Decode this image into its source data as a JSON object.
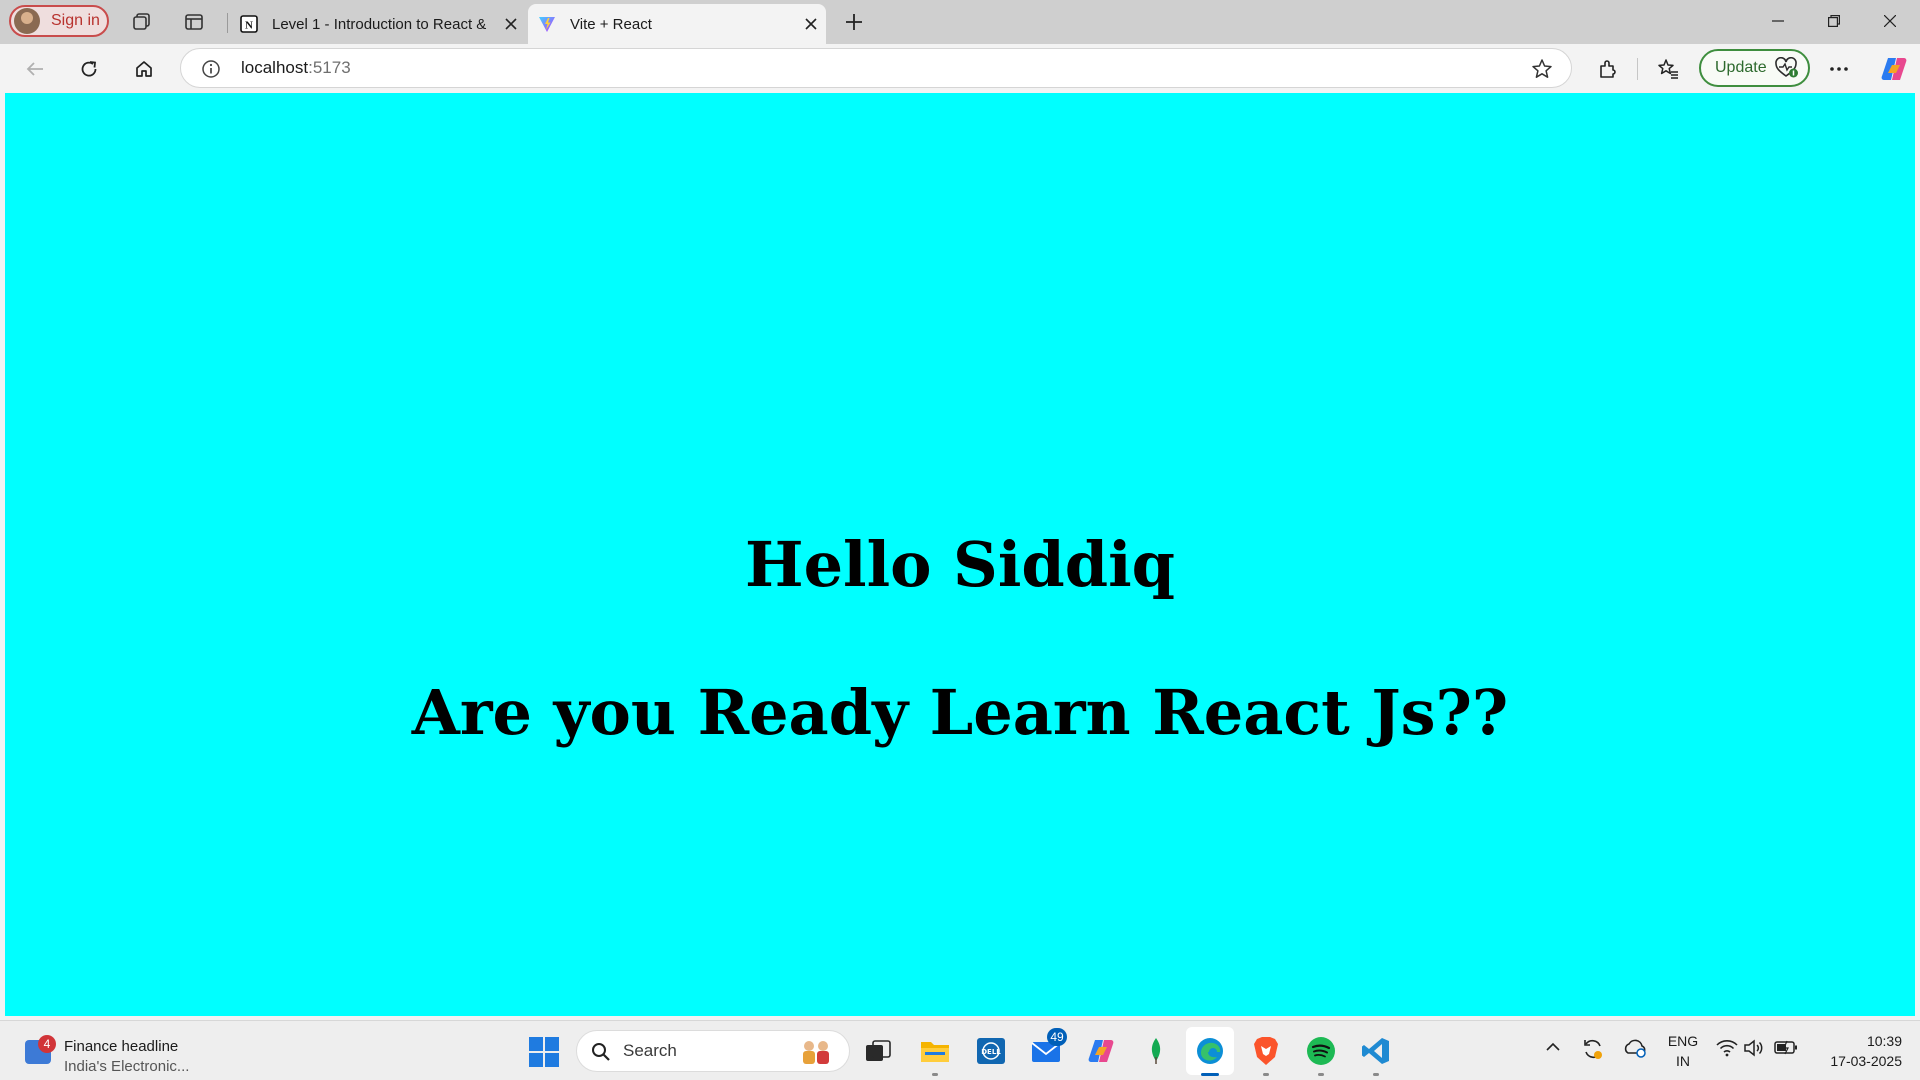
{
  "browser": {
    "profile_label": "Sign in",
    "tabs": [
      {
        "title": "Level 1 - Introduction to React &",
        "favicon": "notion-icon",
        "active": false
      },
      {
        "title": "Vite + React",
        "favicon": "vite-icon",
        "active": true
      }
    ],
    "address": {
      "host": "localhost",
      "port": ":5173"
    },
    "update_label": "Update"
  },
  "page": {
    "background": "#00ffff",
    "heading": "Hello Siddiq",
    "subheading": "Are you Ready Learn React Js??"
  },
  "taskbar": {
    "widget": {
      "badge": "4",
      "headline": "Finance headline",
      "subline": "India's Electronic..."
    },
    "search_label": "Search",
    "apps": [
      {
        "name": "task-view-icon"
      },
      {
        "name": "file-explorer-icon"
      },
      {
        "name": "dell-icon"
      },
      {
        "name": "mail-icon",
        "badge": "49"
      },
      {
        "name": "copilot-icon"
      },
      {
        "name": "mongodb-icon"
      },
      {
        "name": "edge-icon",
        "active": true
      },
      {
        "name": "brave-icon"
      },
      {
        "name": "spotify-icon"
      },
      {
        "name": "vscode-icon"
      }
    ],
    "lang_top": "ENG",
    "lang_bottom": "IN",
    "time": "10:39",
    "date": "17-03-2025"
  },
  "colors": {
    "accent": "#005fb8",
    "page_bg": "#00ffff",
    "signin_red": "#c94c4c",
    "update_green": "#3e8e3e"
  }
}
